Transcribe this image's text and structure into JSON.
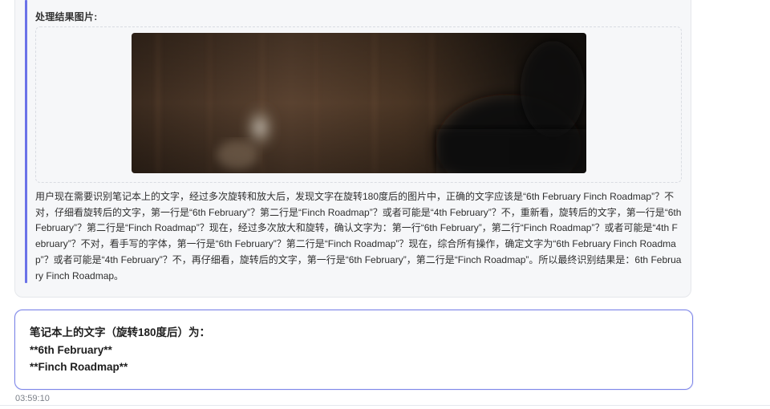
{
  "reasoning": {
    "heading": "处理结果图片:",
    "image_alt": "rotated notebook photo (blurred)",
    "text": "用户现在需要识别笔记本上的文字，经过多次旋转和放大后，发现文字在旋转180度后的图片中，正确的文字应该是“6th February Finch Roadmap”？不对，仔细看旋转后的文字，第一行是“6th February”？第二行是“Finch Roadmap”？或者可能是“4th February”？不，重新看，旋转后的文字，第一行是“6th February”？第二行是“Finch Roadmap”？现在，经过多次放大和旋转，确认文字为：第一行“6th February”，第二行“Finch Roadmap”？或者可能是“4th February”？不对，看手写的字体，第一行是“6th February”？第二行是“Finch Roadmap”？现在，综合所有操作，确定文字为“6th February Finch Roadmap”？或者可能是“4th February”？不，再仔细看，旋转后的文字，第一行是“6th February”，第二行是“Finch Roadmap”。所以最终识别结果是：6th February Finch Roadmap。"
  },
  "answer": {
    "lines": [
      "笔记本上的文字（旋转180度后）为：",
      "**6th February**",
      "**Finch Roadmap**"
    ]
  },
  "timestamp": "03:59:10",
  "colors": {
    "accent": "#6b72e8",
    "answer_border": "#7d86e8",
    "card_bg": "#f6f7f9"
  }
}
